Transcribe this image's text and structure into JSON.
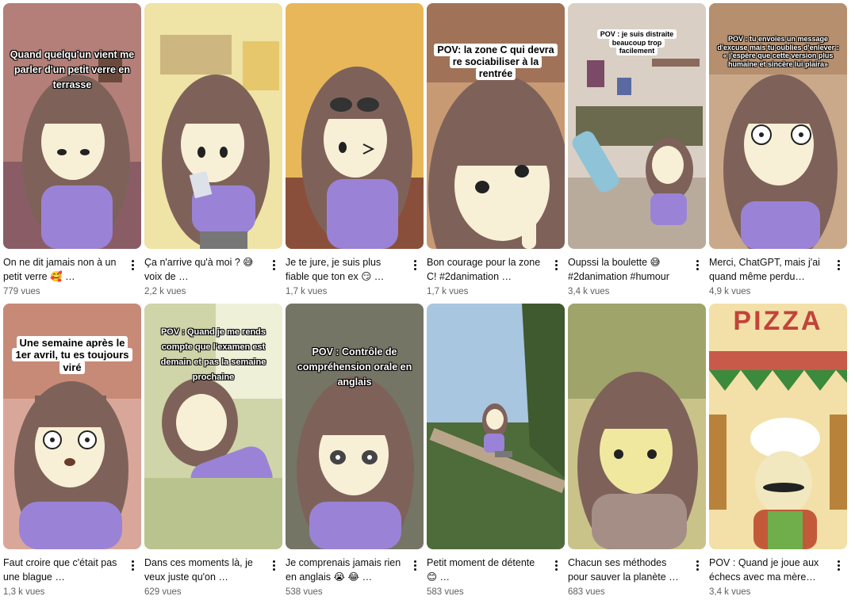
{
  "videos": [
    {
      "caption": "Quand quelqu'un vient me parler d'un petit verre en terrasse",
      "title": "On ne dit jamais non à un petit verre 🥰 …",
      "views": "779 vues"
    },
    {
      "caption": "",
      "title": "Ça n'arrive qu'à moi ? 😅 voix de …",
      "views": "2,2 k vues"
    },
    {
      "caption": "",
      "title": "Je te jure, je suis plus fiable que ton ex 😏 …",
      "views": "1,7 k vues"
    },
    {
      "caption": "POV: la zone C qui devra re sociabiliser à la rentrée",
      "title": "Bon courage pour la zone C! #2danimation …",
      "views": "1,7 k vues"
    },
    {
      "caption": "POV : je suis distraite beaucoup trop facilement",
      "title": "Oupssi la boulette 😅 #2danimation #humour",
      "views": "3,4 k vues"
    },
    {
      "caption": "POV : tu envoies un message d'excuse mais tu oublies d'enlever : « j'espère que cette version plus humaine et sincère lui plaira»",
      "title": "Merci, ChatGPT, mais j'ai quand même perdu…",
      "views": "4,9 k vues"
    },
    {
      "caption": "Une semaine après le 1er avril, tu es toujours viré",
      "title": "Faut croire que c'était pas une blague …",
      "views": "1,3 k vues"
    },
    {
      "caption": "POV : Quand je me rends compte que l'examen est demain et pas la semaine prochaine",
      "title": "Dans ces moments là, je veux juste qu'on …",
      "views": "629 vues"
    },
    {
      "caption": "POV : Contrôle de compréhension orale en anglais",
      "title": "Je comprenais jamais rien en anglais 😭 😂 …",
      "views": "538 vues"
    },
    {
      "caption": "",
      "title": "Petit moment de détente 😊 …",
      "views": "583 vues"
    },
    {
      "caption": "",
      "title": "Chacun ses méthodes pour sauver la planète …",
      "views": "683 vues"
    },
    {
      "caption": "PIZZA",
      "title": "POV : Quand je joue aux échecs avec ma mère…",
      "views": "3,4 k vues"
    }
  ],
  "colors": {
    "views_text": "#606060",
    "title_text": "#0f0f0f",
    "hair": "#7e625a",
    "sweater": "#9a83d6",
    "skin": "#f8f0d6"
  },
  "icons": {
    "more": "more-vert-icon"
  }
}
